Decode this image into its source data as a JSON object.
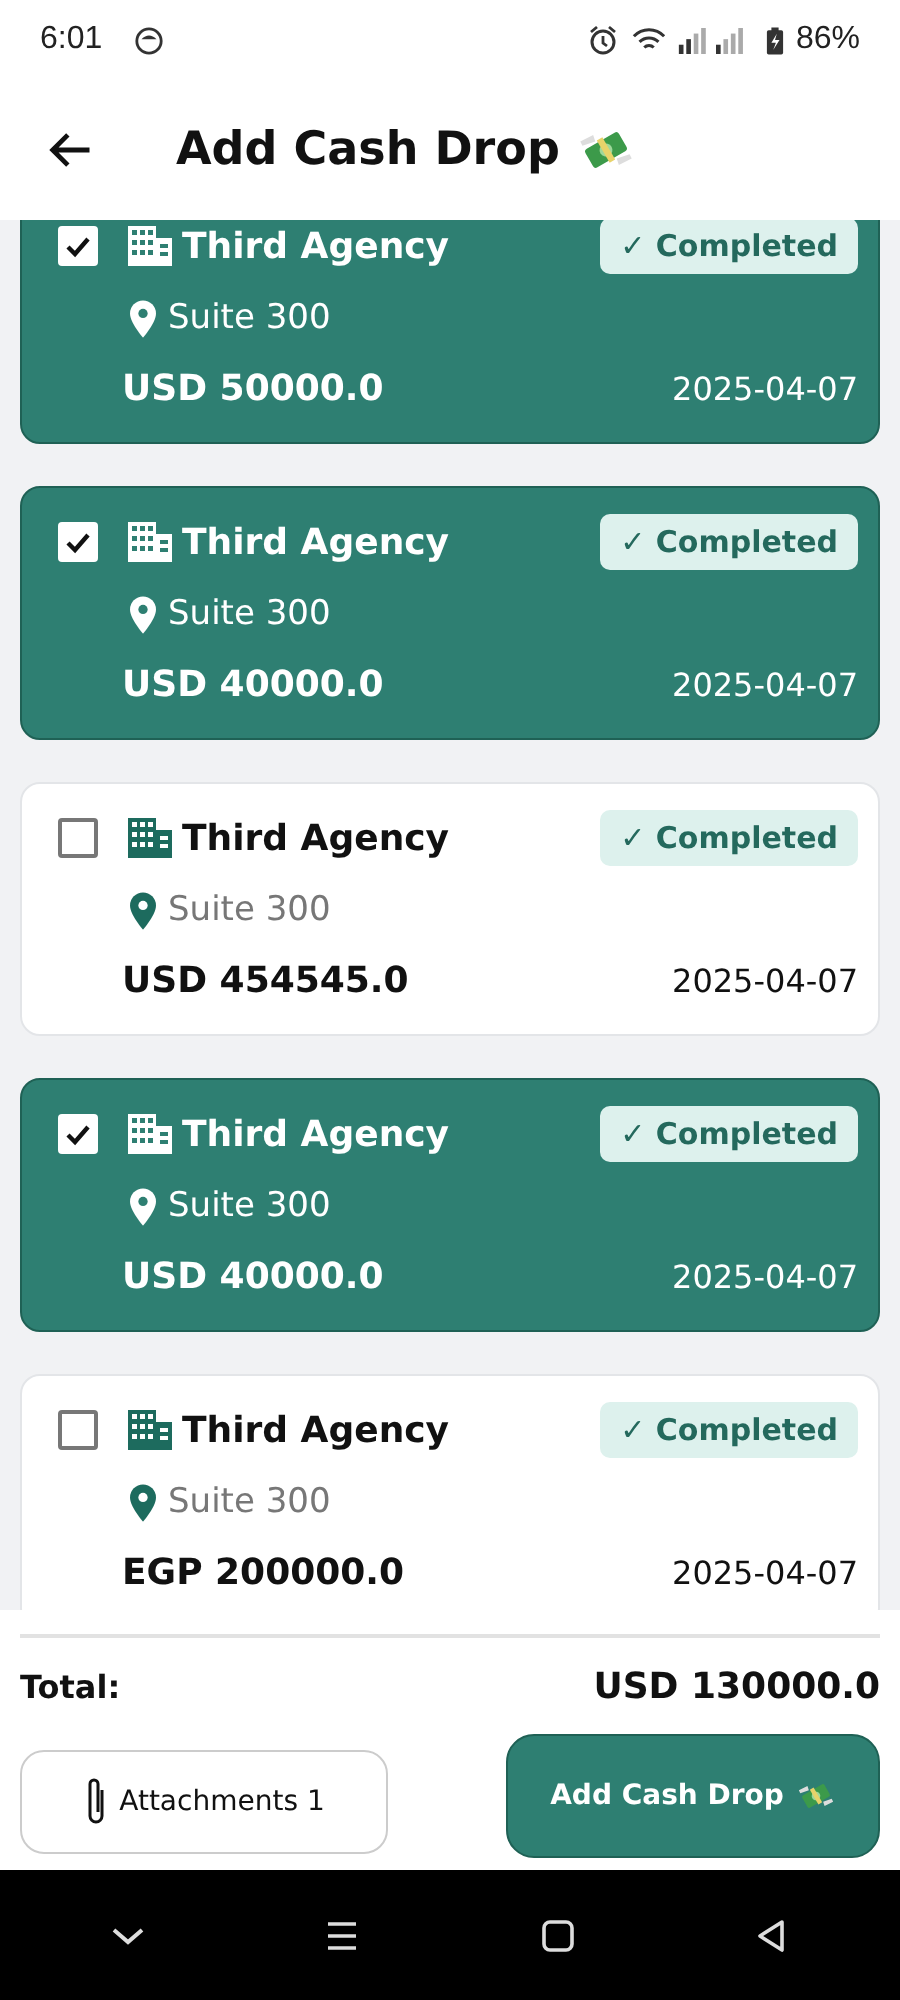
{
  "status_bar": {
    "time": "6:01",
    "battery": "86%"
  },
  "header": {
    "title": "Add Cash Drop"
  },
  "drops": [
    {
      "agency": "Third Agency",
      "location": "Suite 300",
      "amount": "USD 50000.0",
      "date": "2025-04-07",
      "status": "✓ Completed",
      "selected": true
    },
    {
      "agency": "Third Agency",
      "location": "Suite 300",
      "amount": "USD 40000.0",
      "date": "2025-04-07",
      "status": "✓ Completed",
      "selected": true
    },
    {
      "agency": "Third Agency",
      "location": "Suite 300",
      "amount": "USD 454545.0",
      "date": "2025-04-07",
      "status": "✓ Completed",
      "selected": false
    },
    {
      "agency": "Third Agency",
      "location": "Suite 300",
      "amount": "USD 40000.0",
      "date": "2025-04-07",
      "status": "✓ Completed",
      "selected": true
    },
    {
      "agency": "Third Agency",
      "location": "Suite 300",
      "amount": "EGP 200000.0",
      "date": "2025-04-07",
      "status": "✓ Completed",
      "selected": false
    }
  ],
  "footer": {
    "total_label": "Total:",
    "total_value": "USD 130000.0",
    "attachments_button": "Attachments 1",
    "submit_button": "Add Cash Drop"
  }
}
